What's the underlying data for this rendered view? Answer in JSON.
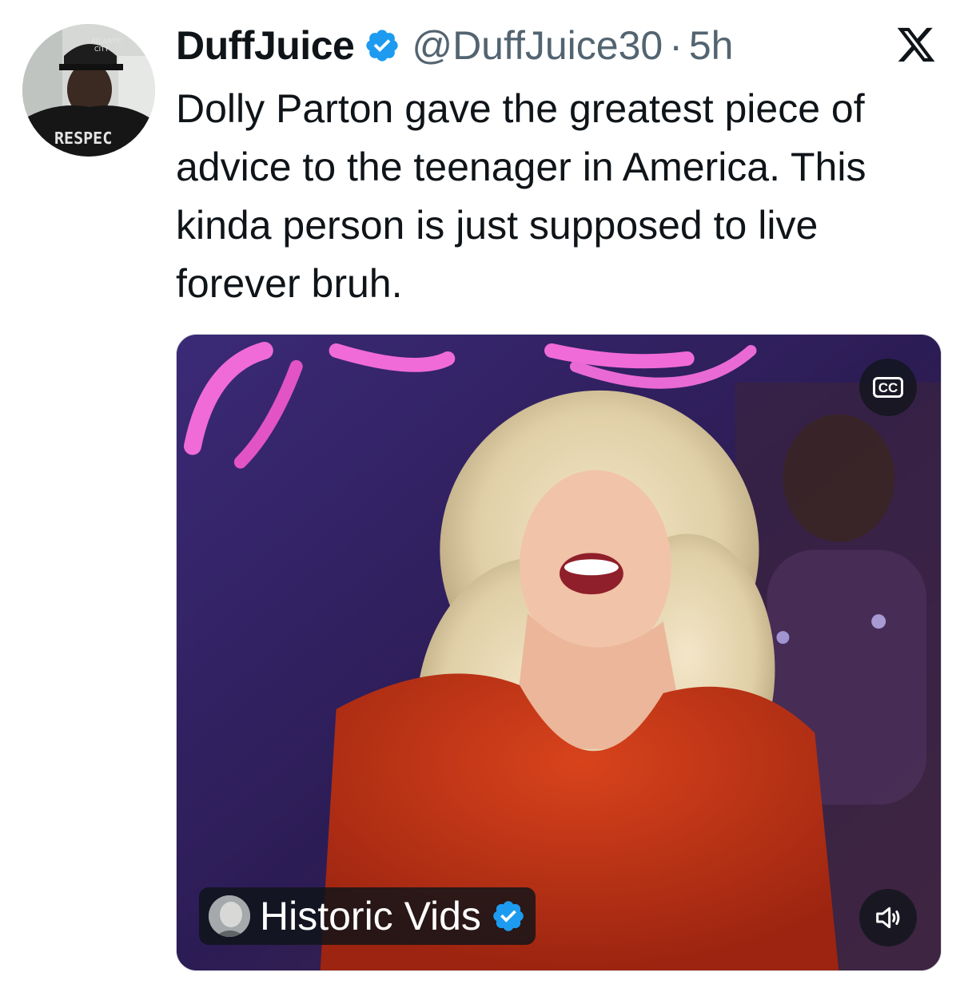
{
  "tweet": {
    "author": {
      "display_name": "DuffJuice",
      "handle": "@DuffJuice30",
      "verified": true,
      "avatar_icon": "user-avatar-photo"
    },
    "separator": "·",
    "time": "5h",
    "platform_icon": "x-logo-icon",
    "text": "Dolly Parton gave the greatest piece of advice to the teenager in America. This kinda person is just supposed to live forever bruh.",
    "media": {
      "type": "video",
      "cc_label": "CC",
      "source": {
        "name": "Historic Vids",
        "verified": true,
        "avatar_icon": "source-avatar-photo"
      },
      "volume_icon": "volume-icon"
    }
  },
  "colors": {
    "text_primary": "#0f1419",
    "text_secondary": "#536471",
    "verified_blue": "#1d9bf0"
  }
}
